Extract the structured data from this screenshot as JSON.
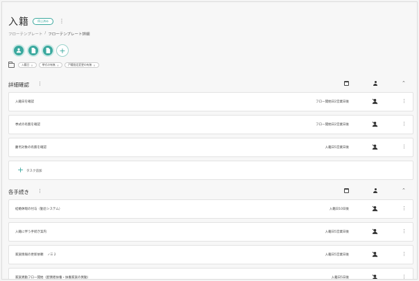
{
  "header": {
    "title": "入籍",
    "status": "停止済み"
  },
  "breadcrumb": {
    "parent": "フローテンプレート",
    "separator": "/",
    "current": "フローテンプレート詳細"
  },
  "actions": [
    {
      "icon": "person-icon"
    },
    {
      "icon": "document-icon"
    },
    {
      "icon": "document-icon"
    },
    {
      "icon": "add-icon"
    }
  ],
  "tags": [
    "入籍日",
    "挙式の有無",
    "戸籍指定変更の有無"
  ],
  "accent_color": "#3aa89e",
  "sections": [
    {
      "name": "詳細確認",
      "tasks": [
        {
          "name": "入籍日を確認",
          "due": "フロー開始日2営業日後"
        },
        {
          "name": "挙式の有無を確認",
          "due": "フロー開始日2営業日後"
        },
        {
          "name": "慶弔対象の有無を確認",
          "due": "入籍日5営業日後"
        }
      ],
      "add_label": "タスク追加"
    },
    {
      "name": "各手続き",
      "tasks": [
        {
          "name": "結婚休暇の付与（勤怠システム）",
          "due": "入籍日10日後"
        },
        {
          "name": "入籍に伴う手続き案内",
          "due": "入籍日5営業日後"
        },
        {
          "name": "家族情報の更新依頼",
          "checklist": "2",
          "due": "入籍日5営業日後"
        },
        {
          "name": "家族異動フロー開始（配偶者扶養・扶養家族の異動）",
          "due": "入籍日5日後"
        }
      ]
    }
  ]
}
